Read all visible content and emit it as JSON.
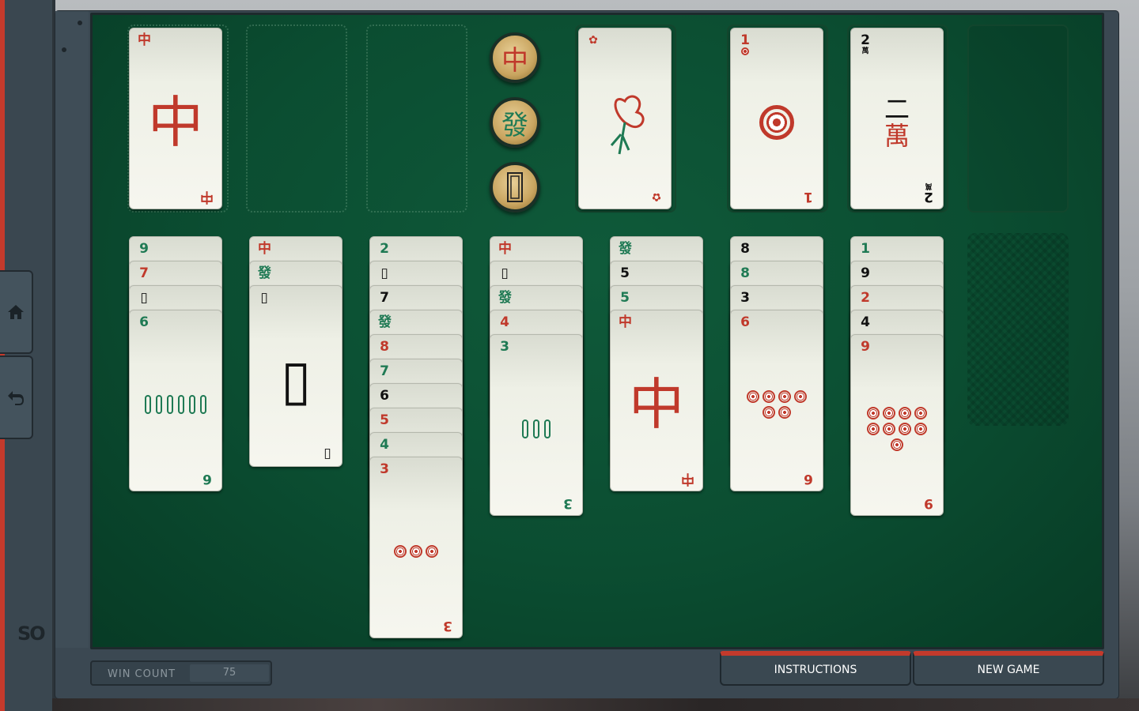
{
  "footer": {
    "win_count_label": "WIN COUNT",
    "win_count_value": "75",
    "instructions_label": "INSTRUCTIONS",
    "new_game_label": "NEW GAME"
  },
  "side": {
    "home_icon": "home-icon",
    "undo_icon": "undo-icon",
    "logo_text": "SO"
  },
  "dragon_buttons": [
    {
      "glyph": "中",
      "color": "#c0392b"
    },
    {
      "glyph": "發",
      "color": "#1f7a54"
    },
    {
      "glyph": "▯",
      "color": "#222222"
    }
  ],
  "free_cells": {
    "cell1": {
      "rank": "中",
      "big": "中"
    }
  },
  "foundation": {
    "flower": {
      "rank": "✿"
    },
    "dots": {
      "rank": "1"
    },
    "characters": {
      "rank": "2",
      "suit": "萬",
      "face_top": "二",
      "face_bottom": "萬"
    }
  },
  "tableau": [
    {
      "ranks": [
        "9",
        "7",
        "▯",
        "6"
      ],
      "colors": [
        "green",
        "red",
        "black",
        "green"
      ],
      "top": "6"
    },
    {
      "ranks": [
        "中",
        "發",
        "▯"
      ],
      "colors": [
        "red",
        "green",
        "black"
      ],
      "top": "▯"
    },
    {
      "ranks": [
        "2",
        "▯",
        "7",
        "發",
        "8",
        "7",
        "6",
        "5",
        "4",
        "3"
      ],
      "colors": [
        "green",
        "black",
        "black",
        "green",
        "red",
        "green",
        "black",
        "red",
        "green",
        "red"
      ],
      "top": "3"
    },
    {
      "ranks": [
        "中",
        "▯",
        "發",
        "4",
        "3"
      ],
      "colors": [
        "red",
        "black",
        "green",
        "red",
        "green"
      ],
      "top": "3"
    },
    {
      "ranks": [
        "發",
        "5",
        "5",
        "中"
      ],
      "colors": [
        "green",
        "black",
        "green",
        "red"
      ],
      "top": "中"
    },
    {
      "ranks": [
        "8",
        "8",
        "3",
        "6"
      ],
      "colors": [
        "black",
        "green",
        "black",
        "red"
      ],
      "top": "6"
    },
    {
      "ranks": [
        "1",
        "9",
        "2",
        "4",
        "9"
      ],
      "colors": [
        "green",
        "black",
        "red",
        "black",
        "red"
      ],
      "top": "9"
    }
  ]
}
